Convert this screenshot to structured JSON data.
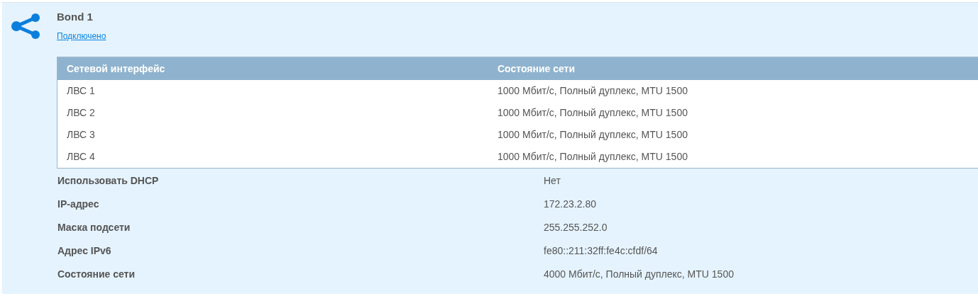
{
  "interface": {
    "title": "Bond 1",
    "status": "Подключено"
  },
  "members_table": {
    "columns": [
      "Сетевой интерфейс",
      "Состояние сети"
    ],
    "rows": [
      [
        "ЛВС 1",
        "1000 Мбит/с, Полный дуплекс, MTU 1500"
      ],
      [
        "ЛВС 2",
        "1000 Мбит/с, Полный дуплекс, MTU 1500"
      ],
      [
        "ЛВС 3",
        "1000 Мбит/с, Полный дуплекс, MTU 1500"
      ],
      [
        "ЛВС 4",
        "1000 Мбит/с, Полный дуплекс, MTU 1500"
      ]
    ]
  },
  "properties": [
    {
      "label": "Использовать DHCP",
      "value": "Нет"
    },
    {
      "label": "IP-адрес",
      "value": "172.23.2.80"
    },
    {
      "label": "Маска подсети",
      "value": "255.255.252.0"
    },
    {
      "label": "Адрес IPv6",
      "value": "fe80::211:32ff:fe4c:cfdf/64"
    },
    {
      "label": "Состояние сети",
      "value": "4000 Мбит/с, Полный дуплекс, MTU 1500"
    }
  ]
}
